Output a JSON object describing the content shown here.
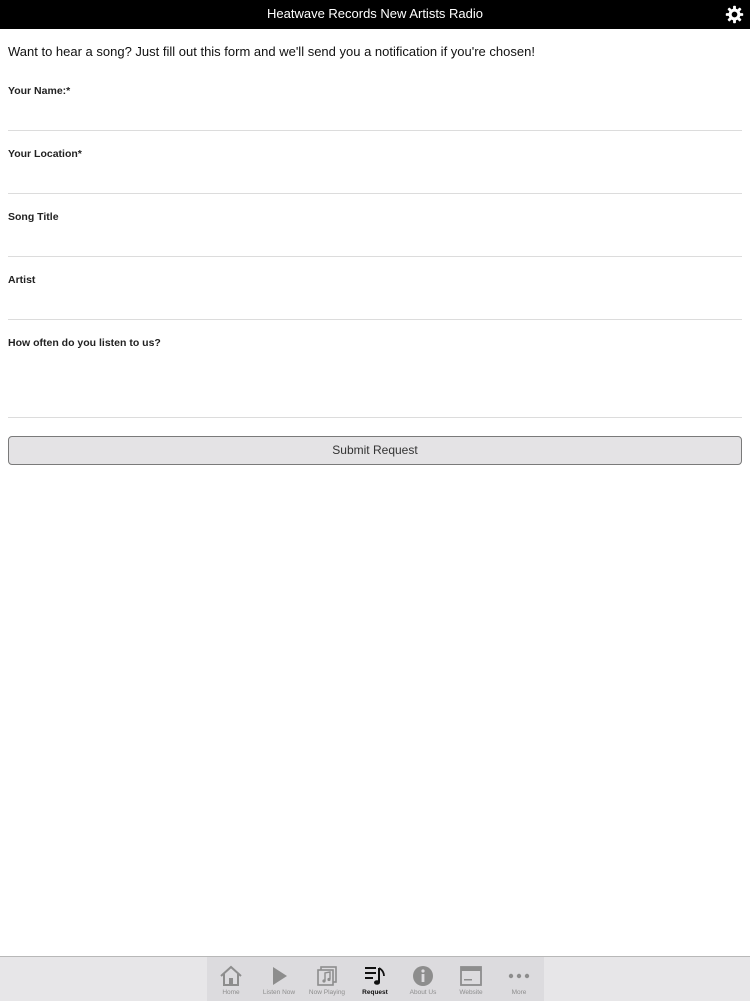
{
  "header": {
    "title": "Heatwave Records New Artists Radio",
    "settings_icon": "gear-icon"
  },
  "form": {
    "intro": "Want to hear a song? Just fill out this form and we'll send you a notification if you're chosen!",
    "fields": [
      {
        "label": "Your Name:*",
        "value": ""
      },
      {
        "label": "Your Location*",
        "value": ""
      },
      {
        "label": "Song Title",
        "value": ""
      },
      {
        "label": "Artist",
        "value": ""
      },
      {
        "label": "How often do you listen to us?",
        "value": ""
      }
    ],
    "submit_label": "Submit Request"
  },
  "tabbar": {
    "active": "Request",
    "tabs": [
      {
        "label": "Home",
        "icon": "home-icon"
      },
      {
        "label": "Listen Now",
        "icon": "play-icon"
      },
      {
        "label": "Now Playing",
        "icon": "music-note-icon"
      },
      {
        "label": "Request",
        "icon": "playlist-icon"
      },
      {
        "label": "About Us",
        "icon": "info-icon"
      },
      {
        "label": "Website",
        "icon": "browser-icon"
      },
      {
        "label": "More",
        "icon": "more-icon"
      }
    ]
  },
  "colors": {
    "header_bg": "#000000",
    "tab_active": "#111111",
    "tab_inactive": "#8d8d8d",
    "button_bg": "#e4e3e5"
  }
}
